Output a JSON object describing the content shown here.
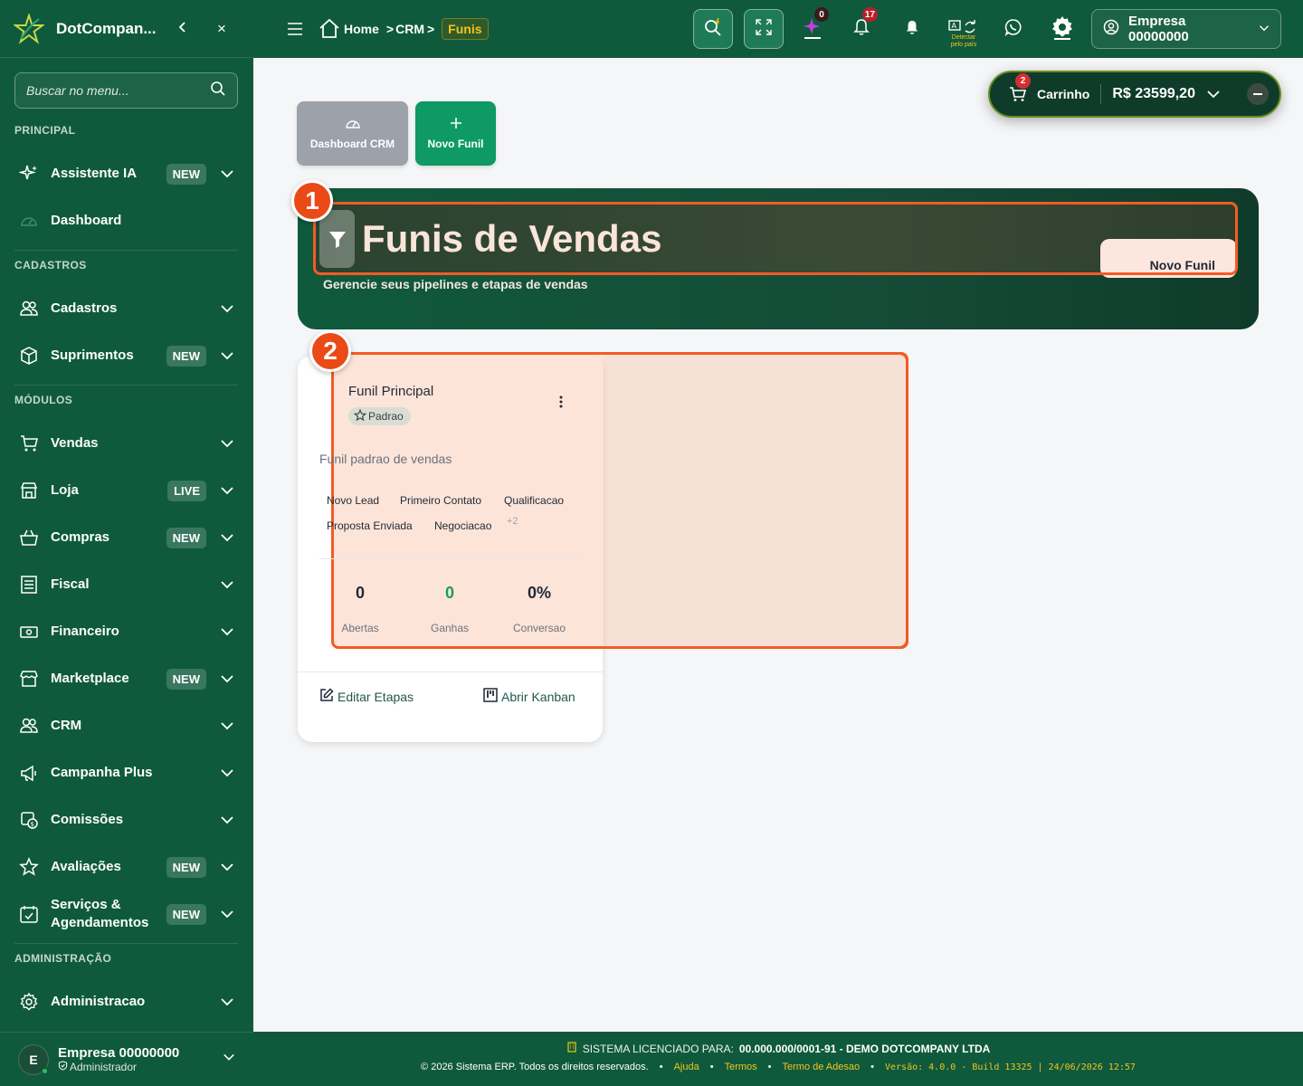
{
  "sidebar": {
    "brand": "DotCompan...",
    "collapse_icon": "chevron-left-icon",
    "close_label": "×",
    "search": {
      "placeholder": "Buscar no menu..."
    },
    "sections": {
      "principal": "PRINCIPAL",
      "cadastros": "CADASTROS",
      "modulos": "MÓDULOS",
      "administracao": "ADMINISTRAÇÃO"
    },
    "items": [
      {
        "label": "Assistente IA",
        "badge": "NEW",
        "icon": "sparkles-icon"
      },
      {
        "label": "Dashboard",
        "badge": "",
        "icon": "dashboard-gauge-icon"
      },
      {
        "label": "Cadastros",
        "badge": "",
        "icon": "users-icon"
      },
      {
        "label": "Suprimentos",
        "badge": "NEW",
        "icon": "box-icon"
      },
      {
        "label": "Vendas",
        "badge": "",
        "icon": "cart-icon"
      },
      {
        "label": "Loja",
        "badge": "LIVE",
        "icon": "store-icon"
      },
      {
        "label": "Compras",
        "badge": "NEW",
        "icon": "basket-icon"
      },
      {
        "label": "Fiscal",
        "badge": "",
        "icon": "document-icon"
      },
      {
        "label": "Financeiro",
        "badge": "",
        "icon": "money-icon"
      },
      {
        "label": "Marketplace",
        "badge": "NEW",
        "icon": "shop-icon"
      },
      {
        "label": "CRM",
        "badge": "",
        "icon": "people-icon"
      },
      {
        "label": "Campanha Plus",
        "badge": "",
        "icon": "megaphone-icon"
      },
      {
        "label": "Comissões",
        "badge": "",
        "icon": "commission-icon"
      },
      {
        "label": "Avaliações",
        "badge": "NEW",
        "icon": "star-icon"
      },
      {
        "label": "Serviços & Agendamentos",
        "badge": "NEW",
        "icon": "calendar-icon"
      },
      {
        "label": "Administracao",
        "badge": "",
        "icon": "gear-icon"
      }
    ],
    "user": {
      "initial": "E",
      "name": "Empresa 00000000",
      "role": "Administrador"
    }
  },
  "topbar": {
    "breadcrumb": {
      "home": "Home",
      "crm": "CRM",
      "current": "Funis"
    },
    "notifications": {
      "ai_count": "0",
      "bell_count": "17"
    },
    "translate_hint": "Detectar pelo país",
    "company": "Empresa 00000000"
  },
  "cart": {
    "count": "2",
    "label": "Carrinho",
    "total": "R$ 23599,20"
  },
  "actions": {
    "dashboard": "Dashboard CRM",
    "novo_funil": "Novo Funil"
  },
  "hero": {
    "title": "Funis de Vendas",
    "subtitle": "Gerencie seus pipelines e etapas de vendas",
    "button": "Novo Funil"
  },
  "callouts": [
    "1",
    "2"
  ],
  "funnel": {
    "name": "Funil Principal",
    "tag": "Padrao",
    "description": "Funil padrao de vendas",
    "stages": [
      "Novo Lead",
      "Primeiro Contato",
      "Qualificacao",
      "Proposta Enviada",
      "Negociacao"
    ],
    "more_stages": "+2",
    "stats": [
      {
        "value": "0",
        "label": "Abertas",
        "color": "#1f2937"
      },
      {
        "value": "0",
        "label": "Ganhas",
        "color": "#16a34a"
      },
      {
        "value": "0%",
        "label": "Conversao",
        "color": "#1f2937"
      }
    ],
    "edit_label": "Editar Etapas",
    "kanban_label": "Abrir Kanban"
  },
  "footer": {
    "license_prefix": "SISTEMA LICENCIADO PARA:",
    "license_value": "00.000.000/0001-91 - DEMO DOTCOMPANY LTDA",
    "copyright": "© 2026 Sistema ERP. Todos os direitos reservados.",
    "links": [
      "Ajuda",
      "Termos",
      "Termo de Adesao"
    ],
    "version": "Versão: 4.0.0 - Build 13325 | 24/06/2026 12:57"
  }
}
